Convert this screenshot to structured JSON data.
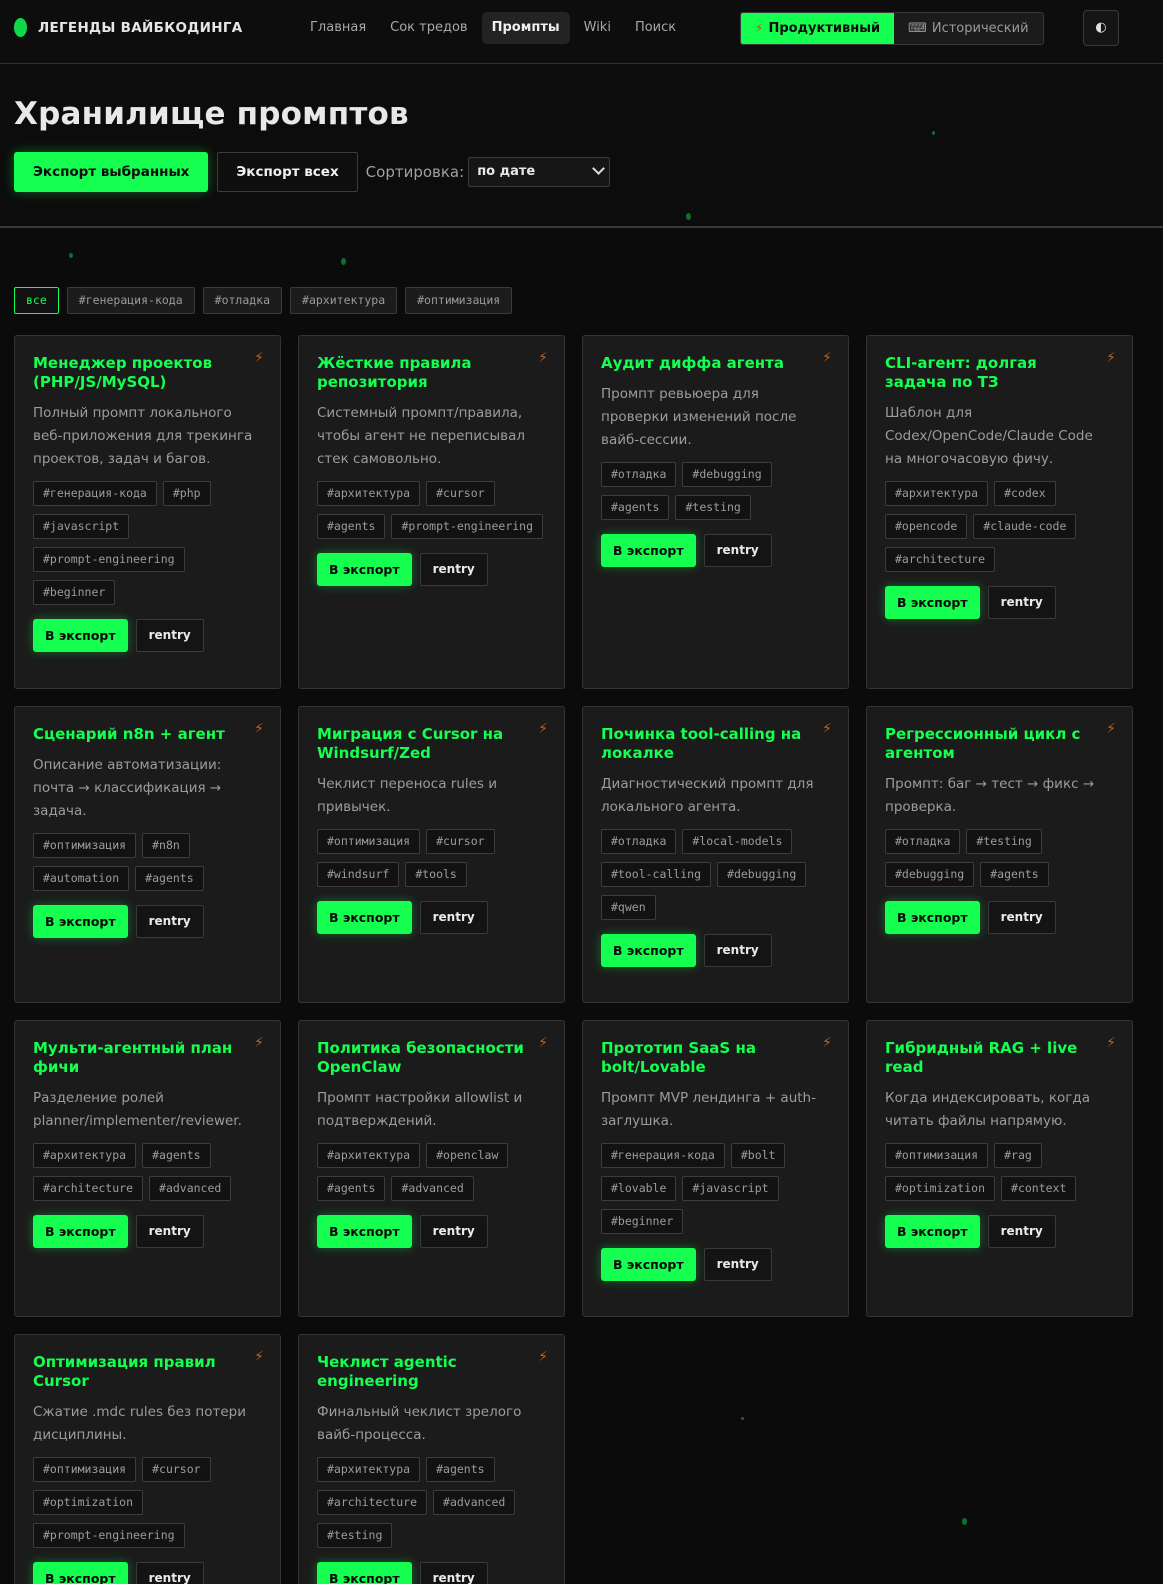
{
  "header": {
    "logo_text": "ЛЕГЕНДЫ ВАЙБКОДИНГА",
    "nav": [
      {
        "label": "Главная",
        "active": false
      },
      {
        "label": "Сок тредов",
        "active": false
      },
      {
        "label": "Промпты",
        "active": true
      },
      {
        "label": "Wiki",
        "active": false
      },
      {
        "label": "Поиск",
        "active": false
      }
    ],
    "mode_productive": "Продуктивный",
    "mode_historical": "Исторический",
    "theme_toggle": "◐"
  },
  "hero": {
    "title": "Хранилище промптов",
    "export_selected": "Экспорт выбранных",
    "export_all": "Экспорт всех",
    "sort_label": "Сортировка:",
    "sort_value": "по дате"
  },
  "filters": [
    "все",
    "#генерация-кода",
    "#отладка",
    "#архитектура",
    "#оптимизация"
  ],
  "cards": [
    {
      "title": "Менеджер проектов (PHP/JS/MySQL)",
      "desc": "Полный промпт локального веб-приложения для трекинга проектов, задач и багов.",
      "tags": [
        "#генерация-кода",
        "#php",
        "#javascript",
        "#prompt-engineering",
        "#beginner"
      ]
    },
    {
      "title": "Жёсткие правила репозитория",
      "desc": "Системный промпт/правила, чтобы агент не переписывал стек самовольно.",
      "tags": [
        "#архитектура",
        "#cursor",
        "#agents",
        "#prompt-engineering"
      ]
    },
    {
      "title": "Аудит диффа агента",
      "desc": "Промпт ревьюера для проверки изменений после вайб-сессии.",
      "tags": [
        "#отладка",
        "#debugging",
        "#agents",
        "#testing"
      ]
    },
    {
      "title": "CLI-агент: долгая задача по ТЗ",
      "desc": "Шаблон для Codex/OpenCode/Claude Code на многочасовую фичу.",
      "tags": [
        "#архитектура",
        "#codex",
        "#opencode",
        "#claude-code",
        "#architecture"
      ]
    },
    {
      "title": "Сценарий n8n + агент",
      "desc": "Описание автоматизации: почта → классификация → задача.",
      "tags": [
        "#оптимизация",
        "#n8n",
        "#automation",
        "#agents"
      ]
    },
    {
      "title": "Миграция с Cursor на Windsurf/Zed",
      "desc": "Чеклист переноса rules и привычек.",
      "tags": [
        "#оптимизация",
        "#cursor",
        "#windsurf",
        "#tools"
      ]
    },
    {
      "title": "Починка tool-calling на локалке",
      "desc": "Диагностический промпт для локального агента.",
      "tags": [
        "#отладка",
        "#local-models",
        "#tool-calling",
        "#debugging",
        "#qwen"
      ]
    },
    {
      "title": "Регрессионный цикл с агентом",
      "desc": "Промпт: баг → тест → фикс → проверка.",
      "tags": [
        "#отладка",
        "#testing",
        "#debugging",
        "#agents"
      ]
    },
    {
      "title": "Мульти-агентный план фичи",
      "desc": "Разделение ролей planner/implementer/reviewer.",
      "tags": [
        "#архитектура",
        "#agents",
        "#architecture",
        "#advanced"
      ]
    },
    {
      "title": "Политика безопасности OpenClaw",
      "desc": "Промпт настройки allowlist и подтверждений.",
      "tags": [
        "#архитектура",
        "#openclaw",
        "#agents",
        "#advanced"
      ]
    },
    {
      "title": "Прототип SaaS на bolt/Lovable",
      "desc": "Промпт MVP лендинга + auth-заглушка.",
      "tags": [
        "#генерация-кода",
        "#bolt",
        "#lovable",
        "#javascript",
        "#beginner"
      ]
    },
    {
      "title": "Гибридный RAG + live read",
      "desc": "Когда индексировать, когда читать файлы напрямую.",
      "tags": [
        "#оптимизация",
        "#rag",
        "#optimization",
        "#context"
      ]
    },
    {
      "title": "Оптимизация правил Cursor",
      "desc": "Сжатие .mdc rules без потери дисциплины.",
      "tags": [
        "#оптимизация",
        "#cursor",
        "#optimization",
        "#prompt-engineering"
      ]
    },
    {
      "title": "Чеклист agentic engineering",
      "desc": "Финальный чеклист зрелого вайб-процесса.",
      "tags": [
        "#архитектура",
        "#agents",
        "#architecture",
        "#advanced",
        "#testing"
      ]
    }
  ],
  "card_export_label": "В экспорт",
  "card_entry_label": "rentry",
  "icons": {
    "card_icon": "bolt-icon",
    "bolt_glyph": "⚡"
  },
  "colors": {
    "accent": "#14ff4f",
    "background": "#0b0b0b",
    "card_bg": "#1b1b1b",
    "icon": "#c0601e"
  }
}
